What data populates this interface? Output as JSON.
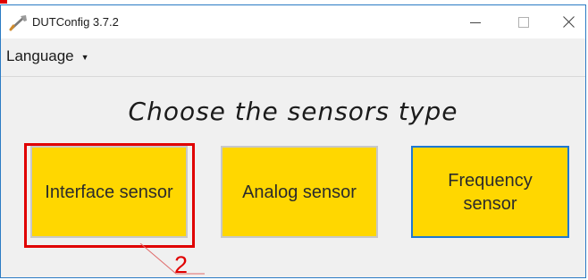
{
  "window": {
    "title": "DUTConfig 3.7.2",
    "app_icon": "wrench-icon",
    "controls": [
      "minimize-icon",
      "maximize-icon",
      "close-icon"
    ]
  },
  "menu": {
    "language_label": "Language"
  },
  "main": {
    "heading": "Choose the sensors type",
    "buttons": [
      {
        "label": "Interface sensor"
      },
      {
        "label": "Analog sensor"
      },
      {
        "label": "Frequency sensor"
      }
    ]
  },
  "annotation": {
    "callout_number": "2"
  },
  "colors": {
    "button_fill": "#ffd700",
    "highlight": "#e00000",
    "focus_border": "#1e78d2"
  }
}
